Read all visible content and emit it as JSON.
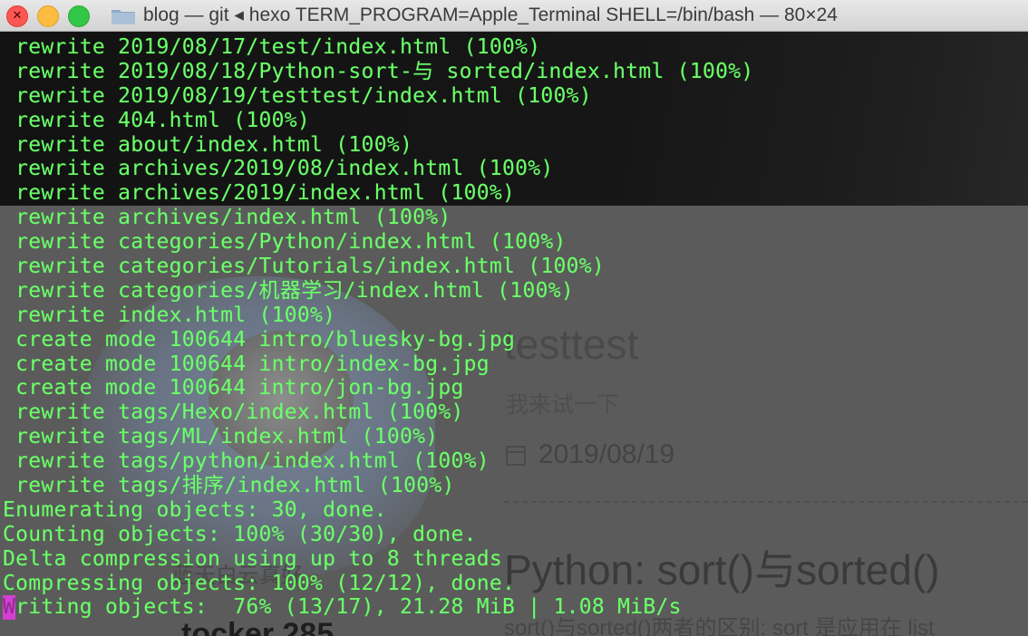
{
  "window": {
    "title": "blog — git ◂ hexo TERM_PROGRAM=Apple_Terminal SHELL=/bin/bash — 80×24",
    "traffic_lights": [
      "close",
      "minimize",
      "zoom"
    ],
    "close_glyph": "✕",
    "folder_icon": "folder-icon"
  },
  "terminal": {
    "text_color": "#6dff6b",
    "cursor_color": "#d33fd3",
    "lines": [
      " rewrite 2019/08/17/test/index.html (100%)",
      " rewrite 2019/08/18/Python-sort-与 sorted/index.html (100%)",
      " rewrite 2019/08/19/testtest/index.html (100%)",
      " rewrite 404.html (100%)",
      " rewrite about/index.html (100%)",
      " rewrite archives/2019/08/index.html (100%)",
      " rewrite archives/2019/index.html (100%)",
      " rewrite archives/index.html (100%)",
      " rewrite categories/Python/index.html (100%)",
      " rewrite categories/Tutorials/index.html (100%)",
      " rewrite categories/机器学习/index.html (100%)",
      " rewrite index.html (100%)",
      " create mode 100644 intro/bluesky-bg.jpg",
      " create mode 100644 intro/index-bg.jpg",
      " create mode 100644 intro/jon-bg.jpg",
      " rewrite tags/Hexo/index.html (100%)",
      " rewrite tags/ML/index.html (100%)",
      " rewrite tags/python/index.html (100%)",
      " rewrite tags/排序/index.html (100%)",
      "Enumerating objects: 30, done.",
      "Counting objects: 100% (30/30), done.",
      "Delta compression using up to 8 threads",
      "Compressing objects: 100% (12/12), done."
    ],
    "last_line_cursor_char": "W",
    "last_line_rest": "riting objects:  76% (13/17), 21.28 MiB | 1.08 MiB/s"
  },
  "background_page": {
    "post1_title": "testtest",
    "post1_subtitle": "我来试一下",
    "post1_date": "2019/08/19",
    "calendar_icon": "calendar-icon",
    "post2_title": "Python: sort()与sorted()",
    "post2_excerpt": "sort()与sorted()两者的区别: sort 是应用在 list",
    "left_text": "蓝天白云真好",
    "left_bottom": "tocker 285"
  }
}
